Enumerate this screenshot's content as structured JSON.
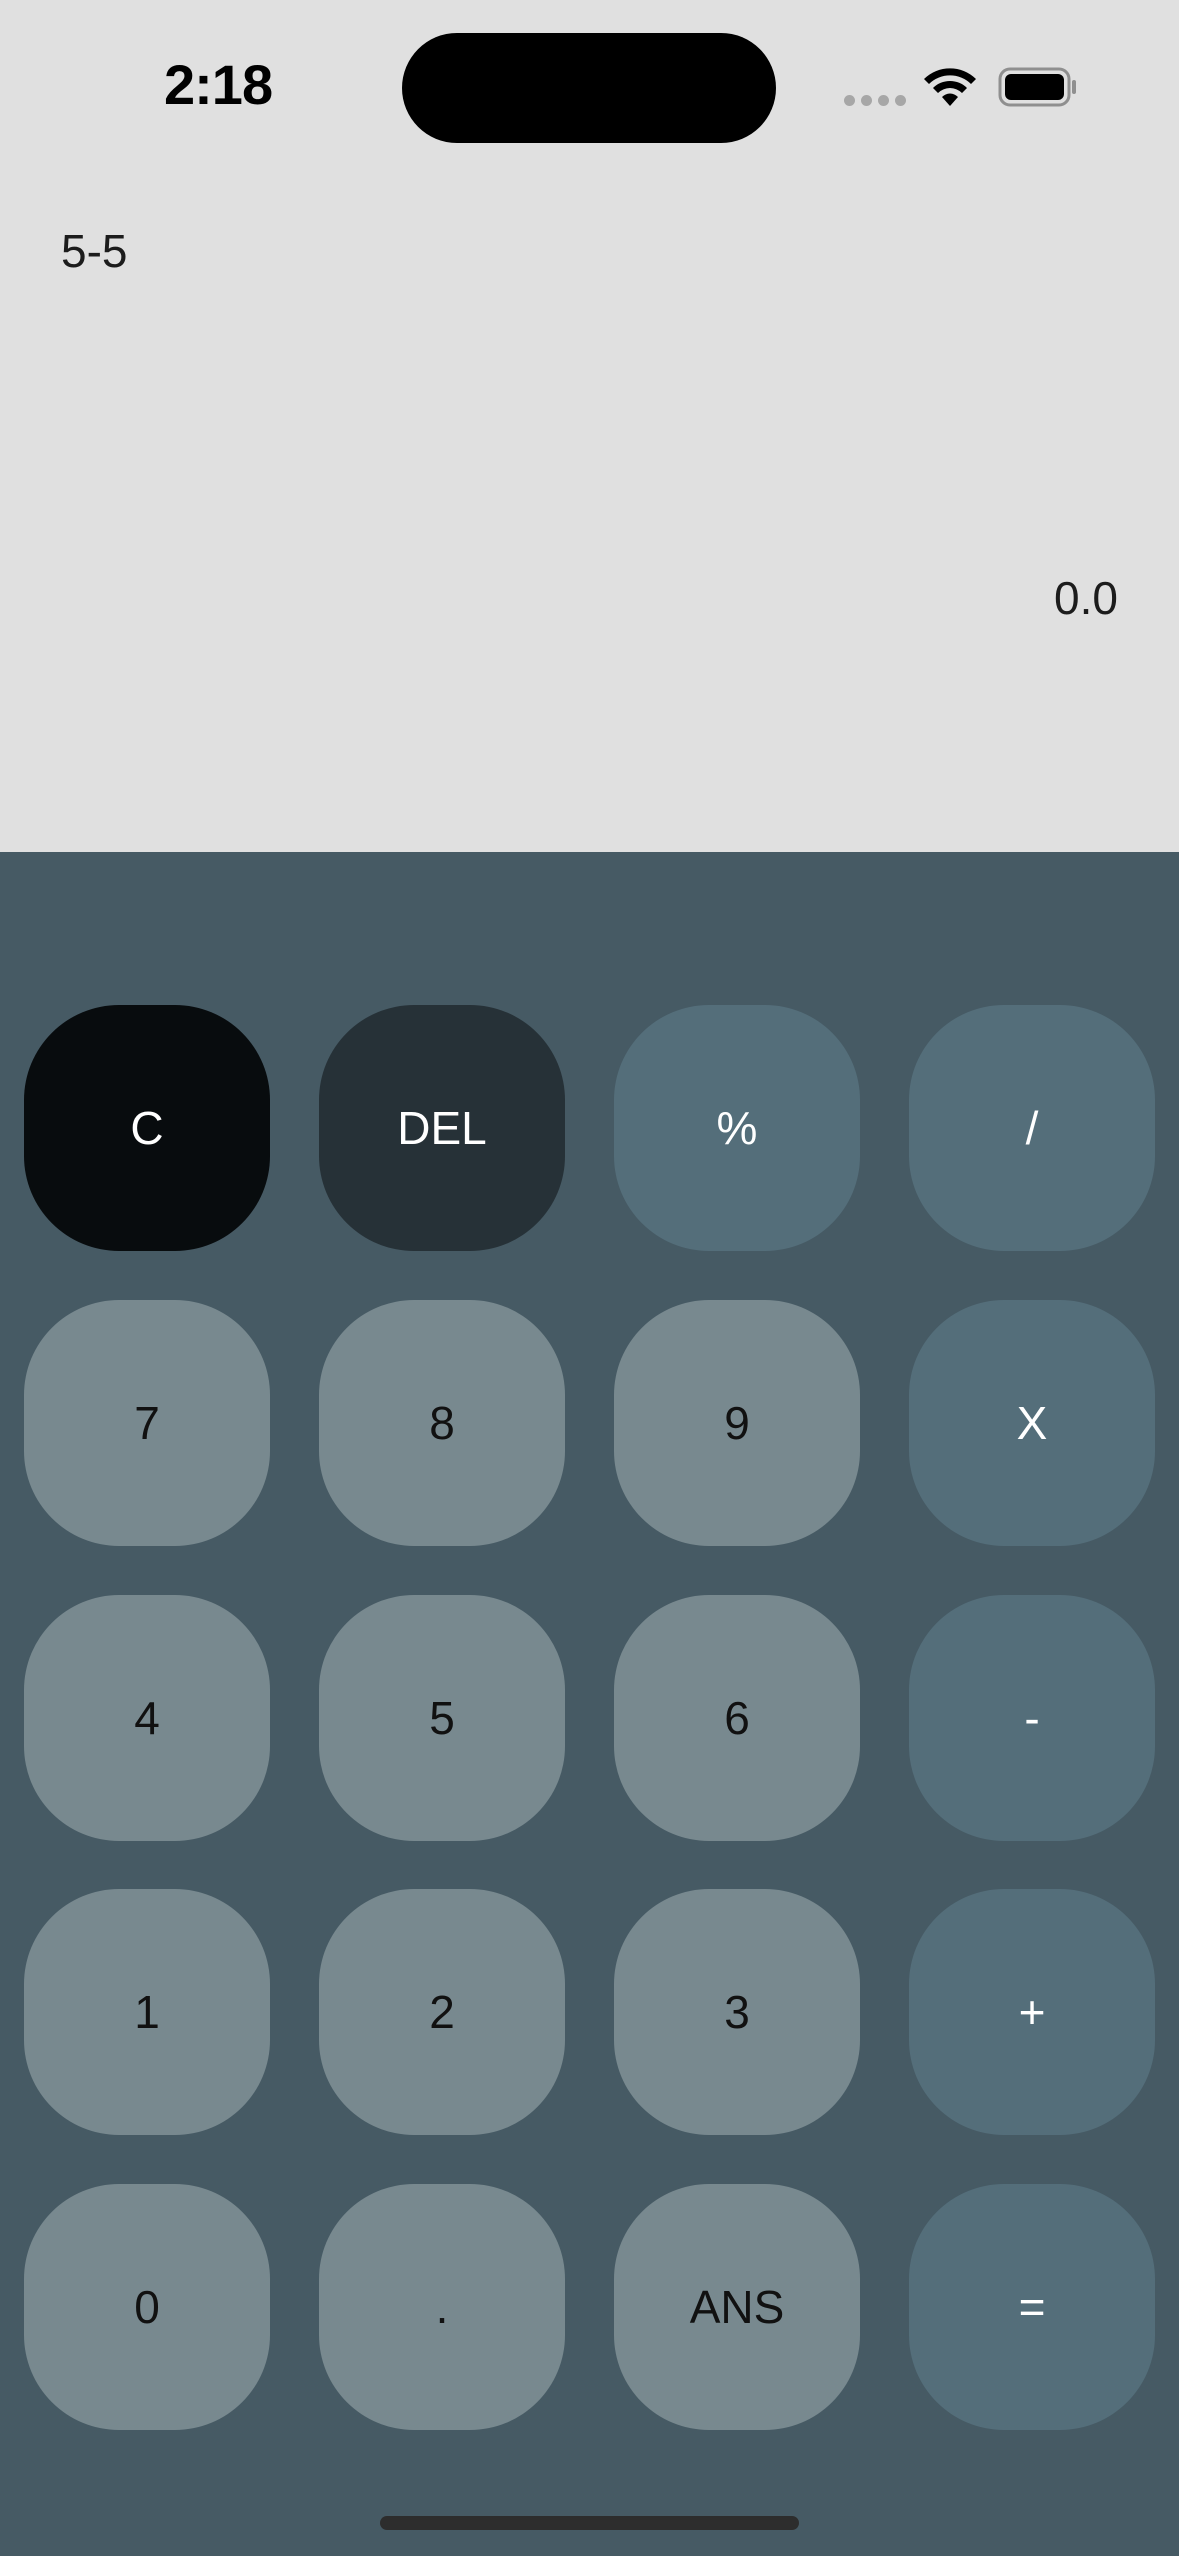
{
  "status_bar": {
    "time": "2:18"
  },
  "display": {
    "expression": "5-5",
    "result": "0.0"
  },
  "keypad": {
    "rows": [
      [
        "C",
        "DEL",
        "%",
        "/"
      ],
      [
        "7",
        "8",
        "9",
        "X"
      ],
      [
        "4",
        "5",
        "6",
        "-"
      ],
      [
        "1",
        "2",
        "3",
        "+"
      ],
      [
        "0",
        ".",
        "ANS",
        "="
      ]
    ]
  },
  "colors": {
    "display_bg": "#e0e0e0",
    "keypad_bg": "#465a64",
    "clear_key": "#080c0e",
    "delete_key": "#263137",
    "operator_key": "#546e7a",
    "number_key": "#78898f"
  }
}
